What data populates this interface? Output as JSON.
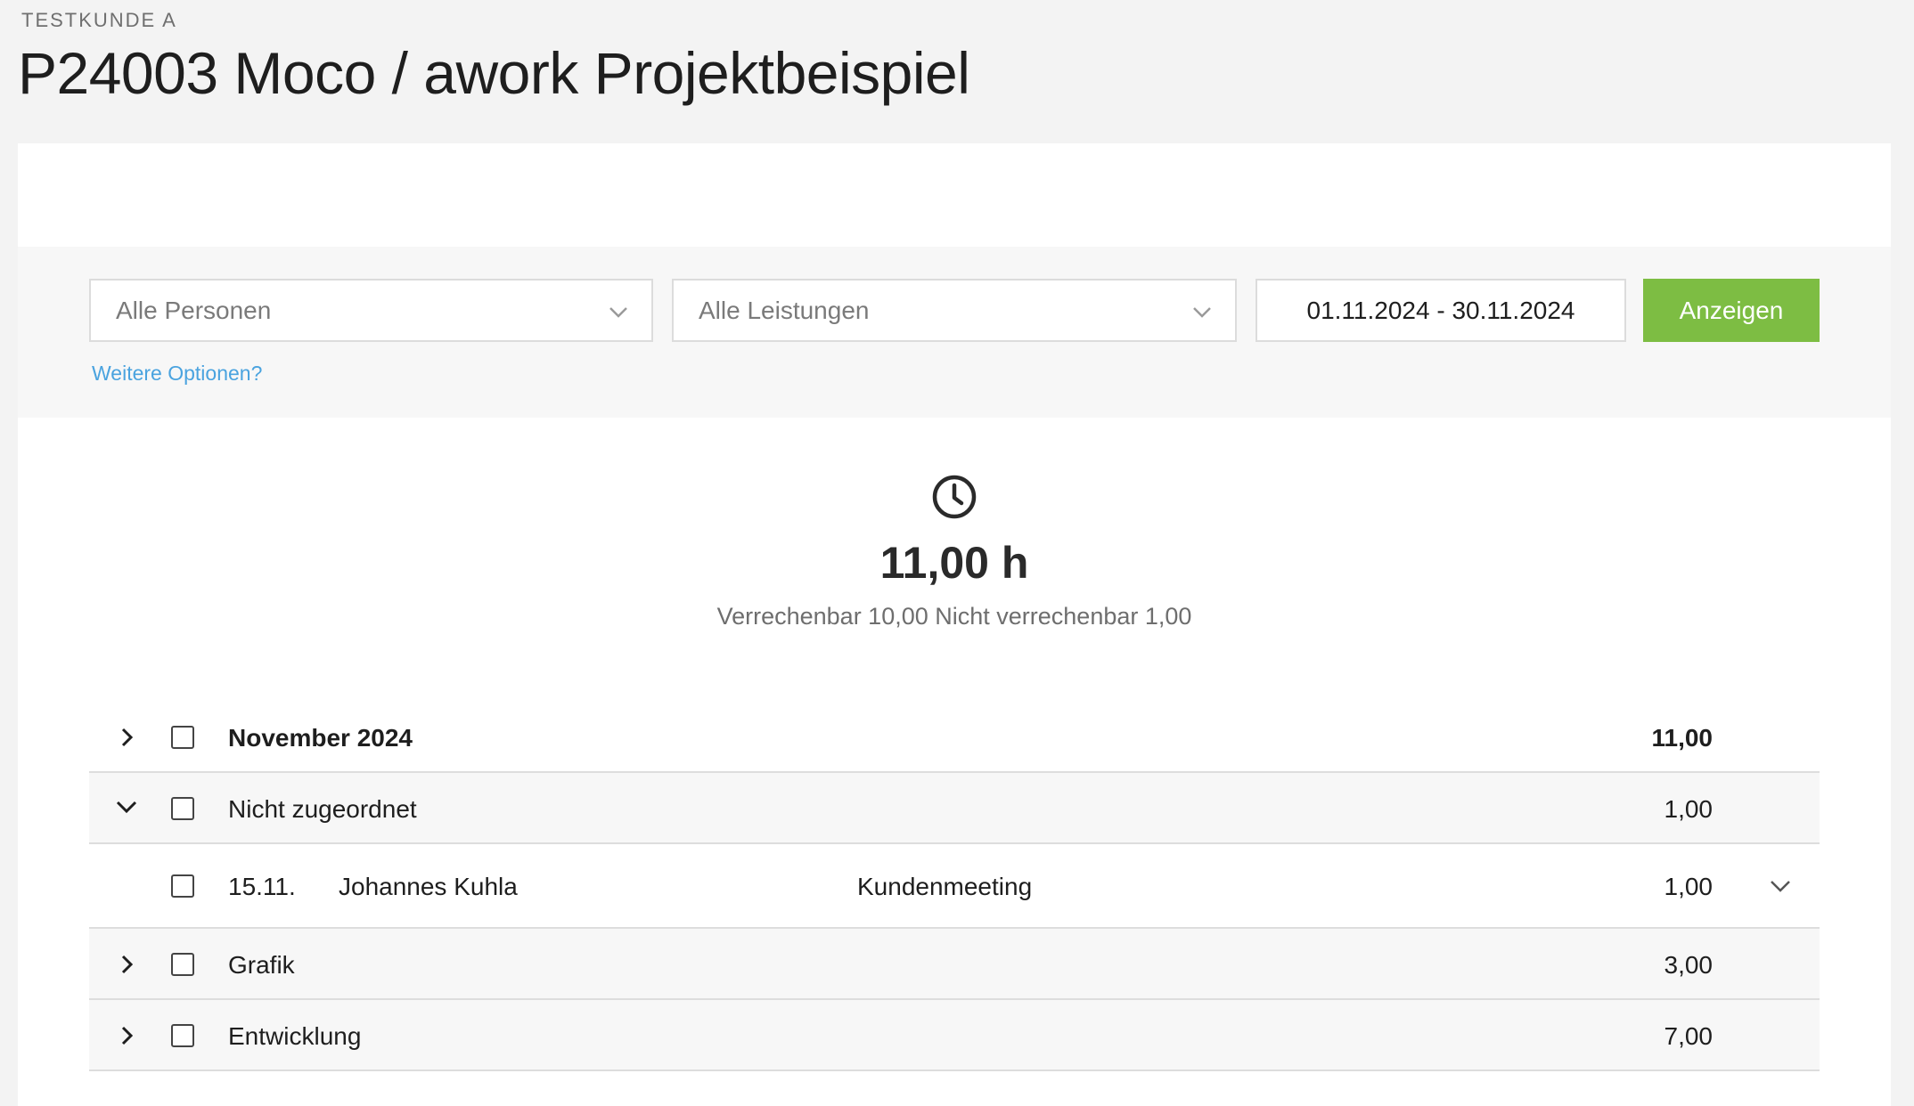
{
  "header": {
    "customer": "TESTKUNDE A",
    "title": "P24003 Moco / awork Projektbeispiel"
  },
  "filters": {
    "persons": "Alle Personen",
    "services": "Alle Leistungen",
    "date_range": "01.11.2024 - 30.11.2024",
    "show_button": "Anzeigen",
    "more_options": "Weitere Optionen?"
  },
  "summary": {
    "icon": "clock-icon",
    "total": "11,00 h",
    "breakdown": "Verrechenbar 10,00 Nicht verrechenbar 1,00"
  },
  "rows": {
    "month": {
      "label": "November 2024",
      "value": "11,00",
      "expanded": false
    },
    "unassigned": {
      "label": "Nicht zugeordnet",
      "value": "1,00",
      "expanded": true
    },
    "entry": {
      "date": "15.11.",
      "person": "Johannes Kuhla",
      "service": "Kundenmeeting",
      "value": "1,00"
    },
    "grafik": {
      "label": "Grafik",
      "value": "3,00",
      "expanded": false
    },
    "entwicklung": {
      "label": "Entwicklung",
      "value": "7,00",
      "expanded": false
    }
  },
  "colors": {
    "accent_button": "#7dbd43",
    "link": "#4aa3df",
    "page_bg": "#f3f3f3"
  }
}
